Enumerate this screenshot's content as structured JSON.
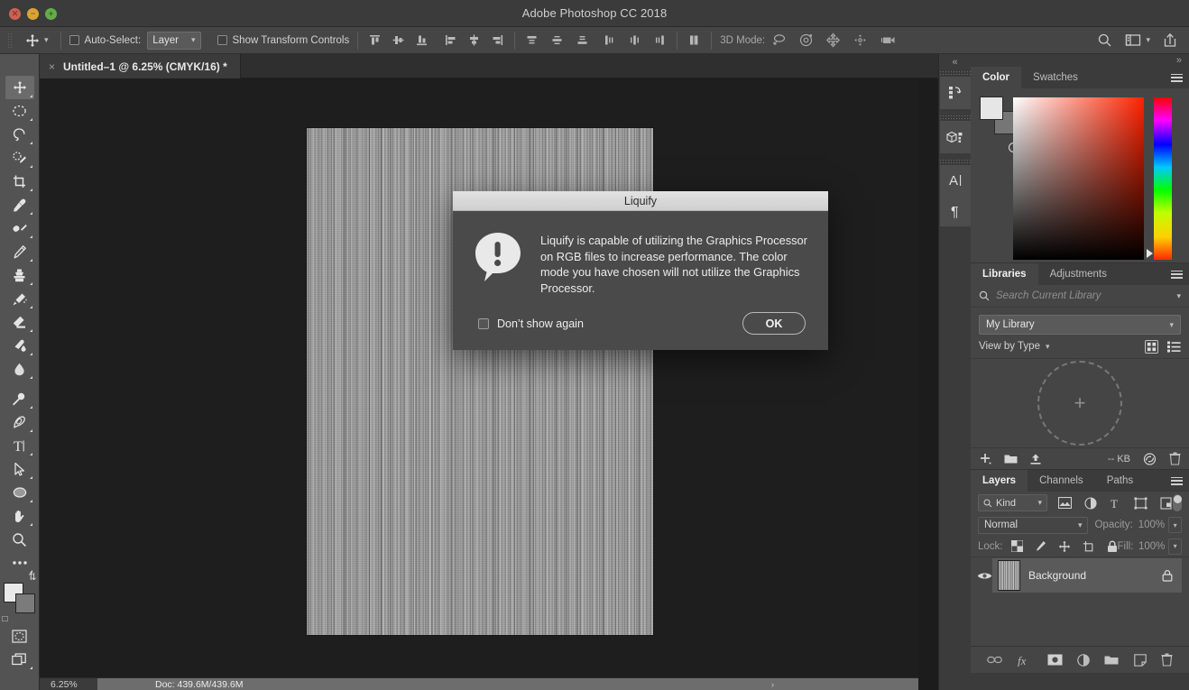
{
  "window": {
    "title": "Adobe Photoshop CC 2018",
    "traffic_lights": [
      "close",
      "minimize",
      "maximize"
    ]
  },
  "options_bar": {
    "tool_preset_icon": "move-tool-icon",
    "auto_select": {
      "label": "Auto-Select:",
      "checked": false,
      "value": "Layer"
    },
    "show_transform": {
      "label": "Show Transform Controls",
      "checked": false
    },
    "align_icons": [
      "align-top-edges-icon",
      "align-vertical-centers-icon",
      "align-bottom-edges-icon",
      "align-left-edges-icon",
      "align-horizontal-centers-icon",
      "align-right-edges-icon"
    ],
    "distribute_icons": [
      "distribute-top-edges-icon",
      "distribute-vertical-centers-icon",
      "distribute-bottom-edges-icon",
      "distribute-left-edges-icon",
      "distribute-horizontal-centers-icon",
      "distribute-right-edges-icon"
    ],
    "extra_icon": "distribute-spacing-icon",
    "mode3d": {
      "label": "3D Mode:",
      "icons": [
        "rotate-3d-icon",
        "roll-3d-icon",
        "pan-3d-icon",
        "slide-3d-icon",
        "camera-3d-icon"
      ]
    },
    "right_icons": [
      "search-icon",
      "workspace-switcher-icon",
      "chevron-down-icon",
      "share-icon"
    ]
  },
  "document_tab": {
    "close_glyph": "×",
    "name": "Untitled–1 @ 6.25% (CMYK/16) *"
  },
  "toolbar": {
    "tools": [
      {
        "name": "move-tool",
        "selected": true,
        "submenu": true
      },
      {
        "name": "elliptical-marquee-tool",
        "selected": false,
        "submenu": true
      },
      {
        "name": "lasso-tool",
        "selected": false,
        "submenu": true
      },
      {
        "name": "quick-selection-tool",
        "selected": false,
        "submenu": true
      },
      {
        "name": "crop-tool",
        "selected": false,
        "submenu": true
      },
      {
        "name": "eyedropper-tool",
        "selected": false,
        "submenu": true
      },
      {
        "name": "healing-brush-tool",
        "selected": false,
        "submenu": true
      },
      {
        "name": "brush-tool",
        "selected": false,
        "submenu": true
      },
      {
        "name": "clone-stamp-tool",
        "selected": false,
        "submenu": true
      },
      {
        "name": "history-brush-tool",
        "selected": false,
        "submenu": true
      },
      {
        "name": "eraser-tool",
        "selected": false,
        "submenu": true
      },
      {
        "name": "gradient-tool",
        "selected": false,
        "submenu": true
      },
      {
        "name": "blur-tool",
        "selected": false,
        "submenu": true
      },
      {
        "name": "dodge-tool",
        "selected": false,
        "submenu": true
      },
      {
        "name": "pen-tool",
        "selected": false,
        "submenu": true
      },
      {
        "name": "type-tool",
        "selected": false,
        "submenu": true
      },
      {
        "name": "path-selection-tool",
        "selected": false,
        "submenu": true
      },
      {
        "name": "ellipse-tool",
        "selected": false,
        "submenu": true
      },
      {
        "name": "hand-tool",
        "selected": false,
        "submenu": true
      },
      {
        "name": "zoom-tool",
        "selected": false,
        "submenu": false
      },
      {
        "name": "edit-toolbar-tool",
        "selected": false,
        "submenu": true
      }
    ],
    "foreground_color": "#e6e6e6",
    "background_color": "#767676",
    "quick_mask": "quick-mask-mode",
    "screen_mode": "screen-mode"
  },
  "canvas": {
    "texture": "vertical-brushed-metal-noise",
    "base_color": "#9d9d9d"
  },
  "status_bar": {
    "zoom": "6.25%",
    "doc_size": "Doc: 439.6M/439.6M",
    "arrow_glyph": "›"
  },
  "icon_dock": {
    "collapse_glyph": "«",
    "items": [
      "history-icon",
      "3d-icon",
      "character-icon",
      "paragraph-icon"
    ]
  },
  "panels": {
    "collapse_glyph": "»",
    "color": {
      "tabs": [
        {
          "label": "Color",
          "active": true
        },
        {
          "label": "Swatches",
          "active": false
        }
      ],
      "menu_icon": "panel-menu-icon",
      "foreground": "#e6e6e6",
      "background": "#767676",
      "spectrum_hue": "#ff2200"
    },
    "libraries": {
      "tabs": [
        {
          "label": "Libraries",
          "active": true
        },
        {
          "label": "Adjustments",
          "active": false
        }
      ],
      "menu_icon": "panel-menu-icon",
      "search_placeholder": "Search Current Library",
      "library_name": "My Library",
      "view_mode": "View by Type",
      "grid_icon": "grid-view-icon",
      "list_icon": "list-view-icon",
      "empty_hint": "+",
      "footer": {
        "add_icon": "add-element-icon",
        "folder_icon": "new-folder-icon",
        "upload_icon": "upload-icon",
        "size": "-- KB",
        "cc_icon": "creative-cloud-icon",
        "trash_icon": "delete-icon"
      }
    },
    "layers": {
      "tabs": [
        {
          "label": "Layers",
          "active": true
        },
        {
          "label": "Channels",
          "active": false
        },
        {
          "label": "Paths",
          "active": false
        }
      ],
      "menu_icon": "panel-menu-icon",
      "filter": {
        "kind": "Kind",
        "icons": [
          "filter-pixel-icon",
          "filter-adjustment-icon",
          "filter-type-icon",
          "filter-shape-icon",
          "filter-smart-object-icon"
        ],
        "toggle": "filter-enable-toggle"
      },
      "blend_mode": "Normal",
      "opacity_label": "Opacity:",
      "opacity_value": "100%",
      "lock_label": "Lock:",
      "lock_icons": [
        "lock-transparent-pixels-icon",
        "lock-image-pixels-icon",
        "lock-position-icon",
        "lock-artboard-icon",
        "lock-all-icon"
      ],
      "fill_label": "Fill:",
      "fill_value": "100%",
      "rows": [
        {
          "name": "Background",
          "visible": true,
          "locked": true,
          "selected": true
        }
      ],
      "footer_icons": [
        "link-layers-icon",
        "layer-style-fx-icon",
        "add-mask-icon",
        "adjustment-layer-icon",
        "new-group-icon",
        "new-layer-icon",
        "delete-layer-icon"
      ]
    }
  },
  "dialog": {
    "title": "Liquify",
    "icon": "warning-alert-icon",
    "message": "Liquify is capable of utilizing the Graphics Processor on RGB files to increase performance. The color mode you have chosen will not utilize the Graphics Processor.",
    "dont_show": {
      "label": "Don’t show again",
      "checked": false
    },
    "ok_label": "OK"
  }
}
